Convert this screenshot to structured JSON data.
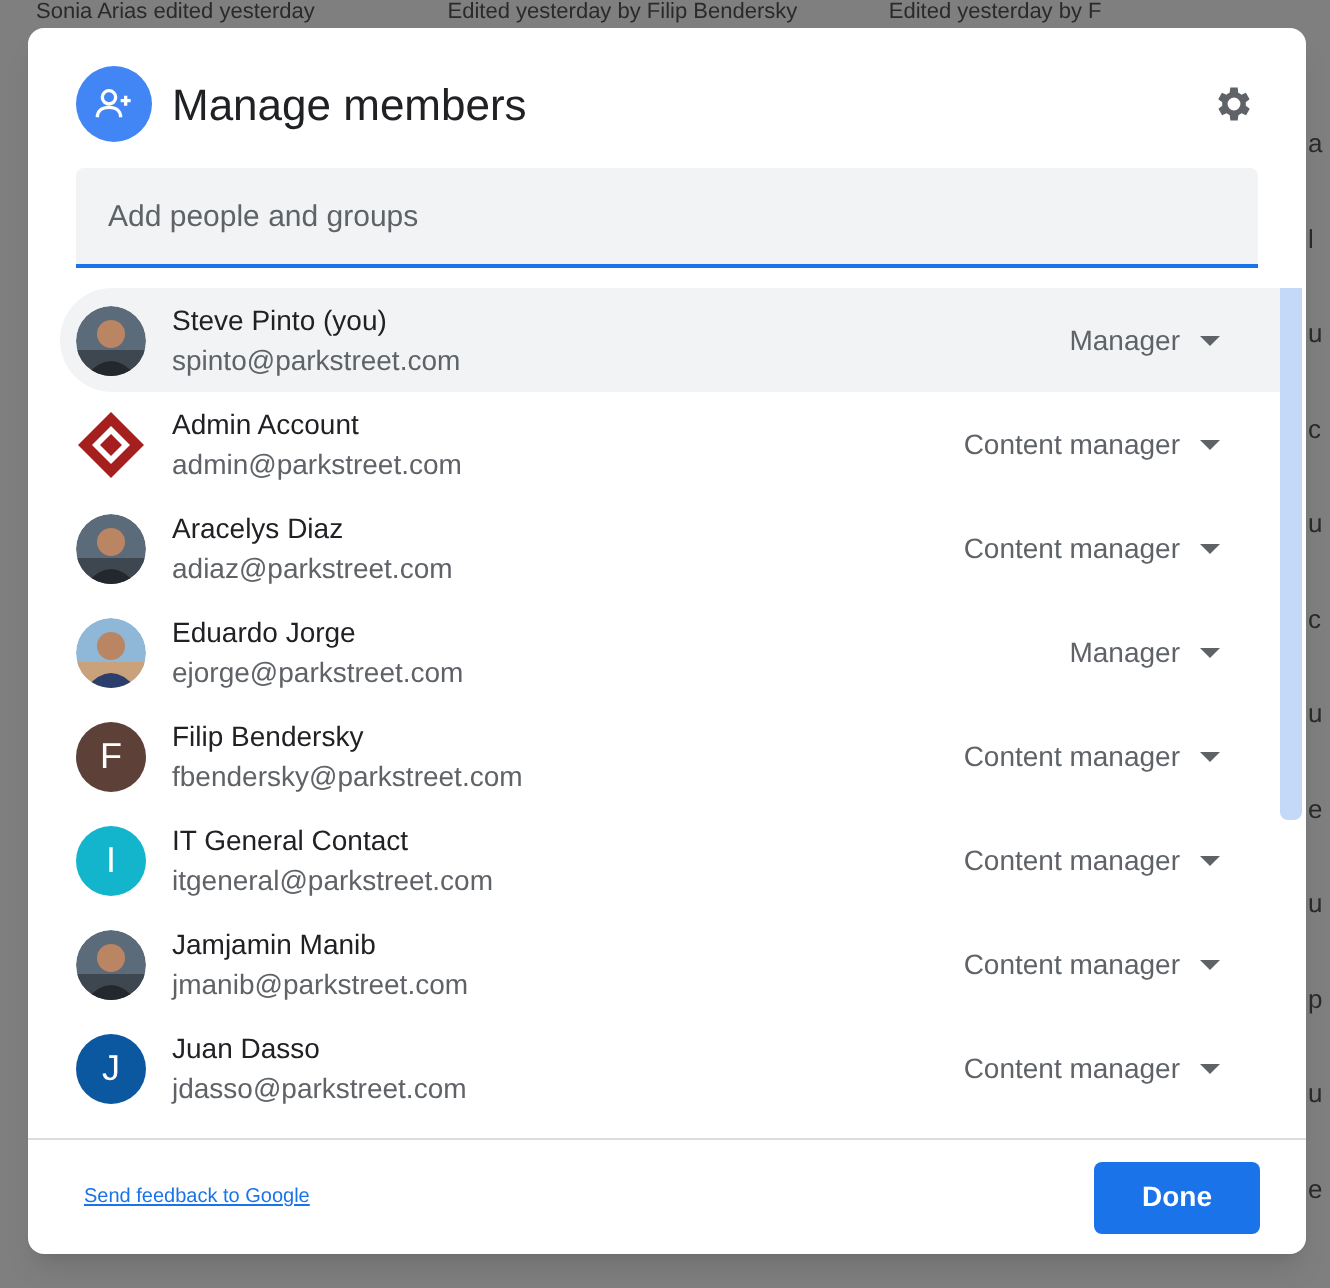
{
  "background": {
    "top_cells": [
      "Sonia Arias edited yesterday",
      "Edited yesterday by Filip Bendersky",
      "Edited yesterday by F"
    ],
    "right_fragments": [
      "a",
      "l",
      "u",
      "c",
      "u",
      "c",
      "u",
      "e",
      "u",
      "p",
      "u",
      "e"
    ]
  },
  "dialog": {
    "title": "Manage members",
    "search": {
      "placeholder": "Add people and groups"
    },
    "members": [
      {
        "name": "Steve Pinto (you)",
        "email": "spinto@parkstreet.com",
        "role": "Manager",
        "selected": true
      },
      {
        "name": "Admin Account",
        "email": "admin@parkstreet.com",
        "role": "Content manager",
        "kind": "logo",
        "selected": false
      },
      {
        "name": "Aracelys Diaz",
        "email": "adiaz@parkstreet.com",
        "role": "Content manager",
        "selected": false
      },
      {
        "name": "Eduardo Jorge",
        "email": "ejorge@parkstreet.com",
        "role": "Manager",
        "selected": false
      },
      {
        "name": "Filip Bendersky",
        "email": "fbendersky@parkstreet.com",
        "role": "Content manager",
        "kind": "letter",
        "letter": "F",
        "color": "#5d4037",
        "selected": false
      },
      {
        "name": "IT General Contact",
        "email": "itgeneral@parkstreet.com",
        "role": "Content manager",
        "kind": "letter",
        "letter": "I",
        "color": "#12b5cb",
        "selected": false
      },
      {
        "name": "Jamjamin Manib",
        "email": "jmanib@parkstreet.com",
        "role": "Content manager",
        "selected": false
      },
      {
        "name": "Juan Dasso",
        "email": "jdasso@parkstreet.com",
        "role": "Content manager",
        "kind": "letter",
        "letter": "J",
        "color": "#0b57a0",
        "selected": false
      }
    ],
    "feedback_link": "Send feedback to Google",
    "done_button": "Done"
  }
}
